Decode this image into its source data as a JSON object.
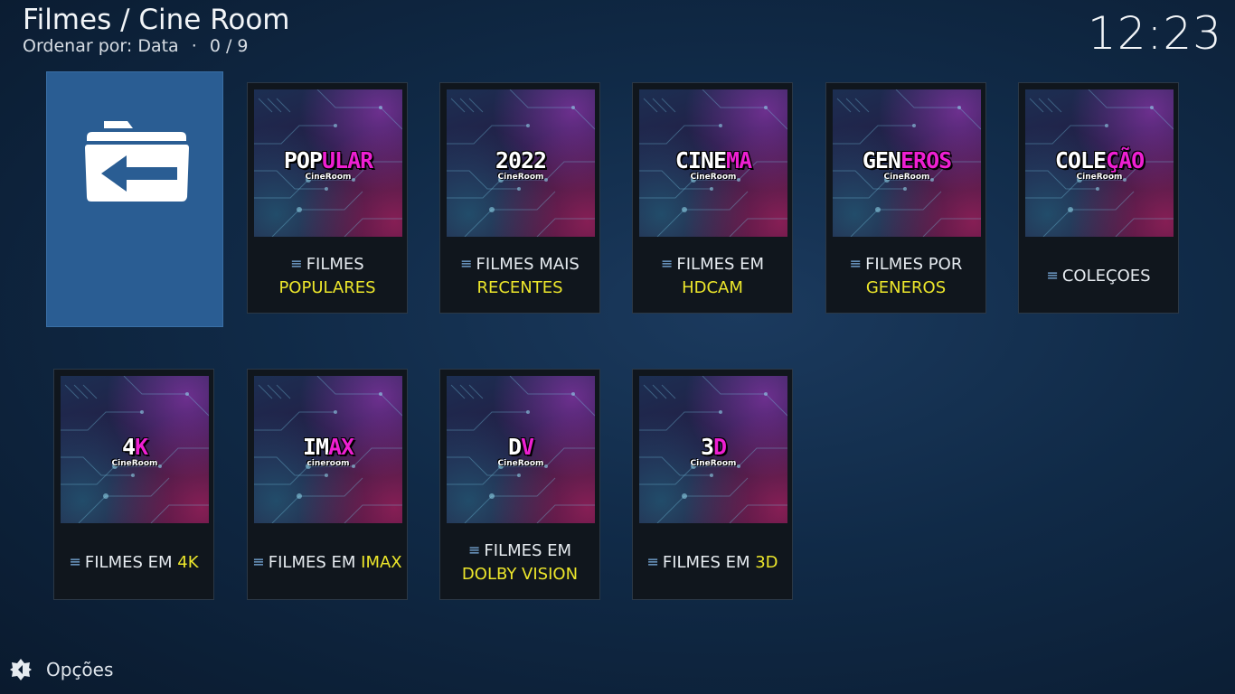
{
  "header": {
    "title": "Filmes / Cine Room",
    "sort_label": "Ordenar por: Data",
    "separator": "·",
    "count": "0 / 9"
  },
  "clock": "12:23",
  "back_item": {
    "icon": "folder-back-icon"
  },
  "tiles": [
    {
      "poster_title": "POPULAR",
      "poster_split": 3,
      "poster_brand": "CineRoom",
      "caption_l1_white": "FILMES",
      "caption_l1_yellow": "",
      "caption_l2_white": "",
      "caption_l2_yellow": "POPULARES"
    },
    {
      "poster_title": "2022",
      "poster_split": 4,
      "poster_brand": "CineRoom",
      "caption_l1_white": "FILMES MAIS",
      "caption_l1_yellow": "",
      "caption_l2_white": "",
      "caption_l2_yellow": "RECENTES"
    },
    {
      "poster_title": "CINEMA",
      "poster_split": 4,
      "poster_brand": "CineRoom",
      "caption_l1_white": "FILMES EM",
      "caption_l1_yellow": "",
      "caption_l2_white": "",
      "caption_l2_yellow": "HDCAM"
    },
    {
      "poster_title": "GENEROS",
      "poster_split": 3,
      "poster_brand": "CineRoom",
      "caption_l1_white": "FILMES POR",
      "caption_l1_yellow": "",
      "caption_l2_white": "",
      "caption_l2_yellow": "GENEROS"
    },
    {
      "poster_title": "COLEÇÃO",
      "poster_split": 4,
      "poster_brand": "CineRoom",
      "caption_l1_white": "COLEÇOES",
      "caption_l1_yellow": "",
      "caption_l2_white": "",
      "caption_l2_yellow": ""
    },
    {
      "poster_title": "4K",
      "poster_split": 1,
      "poster_brand": "CineRoom",
      "caption_l1_white": "FILMES EM ",
      "caption_l1_yellow": "4K",
      "caption_l2_white": "",
      "caption_l2_yellow": ""
    },
    {
      "poster_title": "IMAX",
      "poster_split": 2,
      "poster_brand": "cineroom",
      "caption_l1_white": "FILMES EM ",
      "caption_l1_yellow": "IMAX",
      "caption_l2_white": "",
      "caption_l2_yellow": ""
    },
    {
      "poster_title": "DV",
      "poster_split": 1,
      "poster_brand": "CineRoom",
      "caption_l1_white": "FILMES EM",
      "caption_l1_yellow": "",
      "caption_l2_white": "",
      "caption_l2_yellow": "DOLBY VISION"
    },
    {
      "poster_title": "3D",
      "poster_split": 1,
      "poster_brand": "CineRoom",
      "caption_l1_white": "FILMES EM ",
      "caption_l1_yellow": "3D",
      "caption_l2_white": "",
      "caption_l2_yellow": ""
    }
  ],
  "colors": {
    "highlight": "#ece62b",
    "poster_white": "#ffffff",
    "poster_pink": "#ee1fd2",
    "menu_icon": "#7fb2e5",
    "selected_tile": "#2a5d93"
  },
  "footer": {
    "options_label": "Opções",
    "options_icon": "options-gear-icon"
  }
}
